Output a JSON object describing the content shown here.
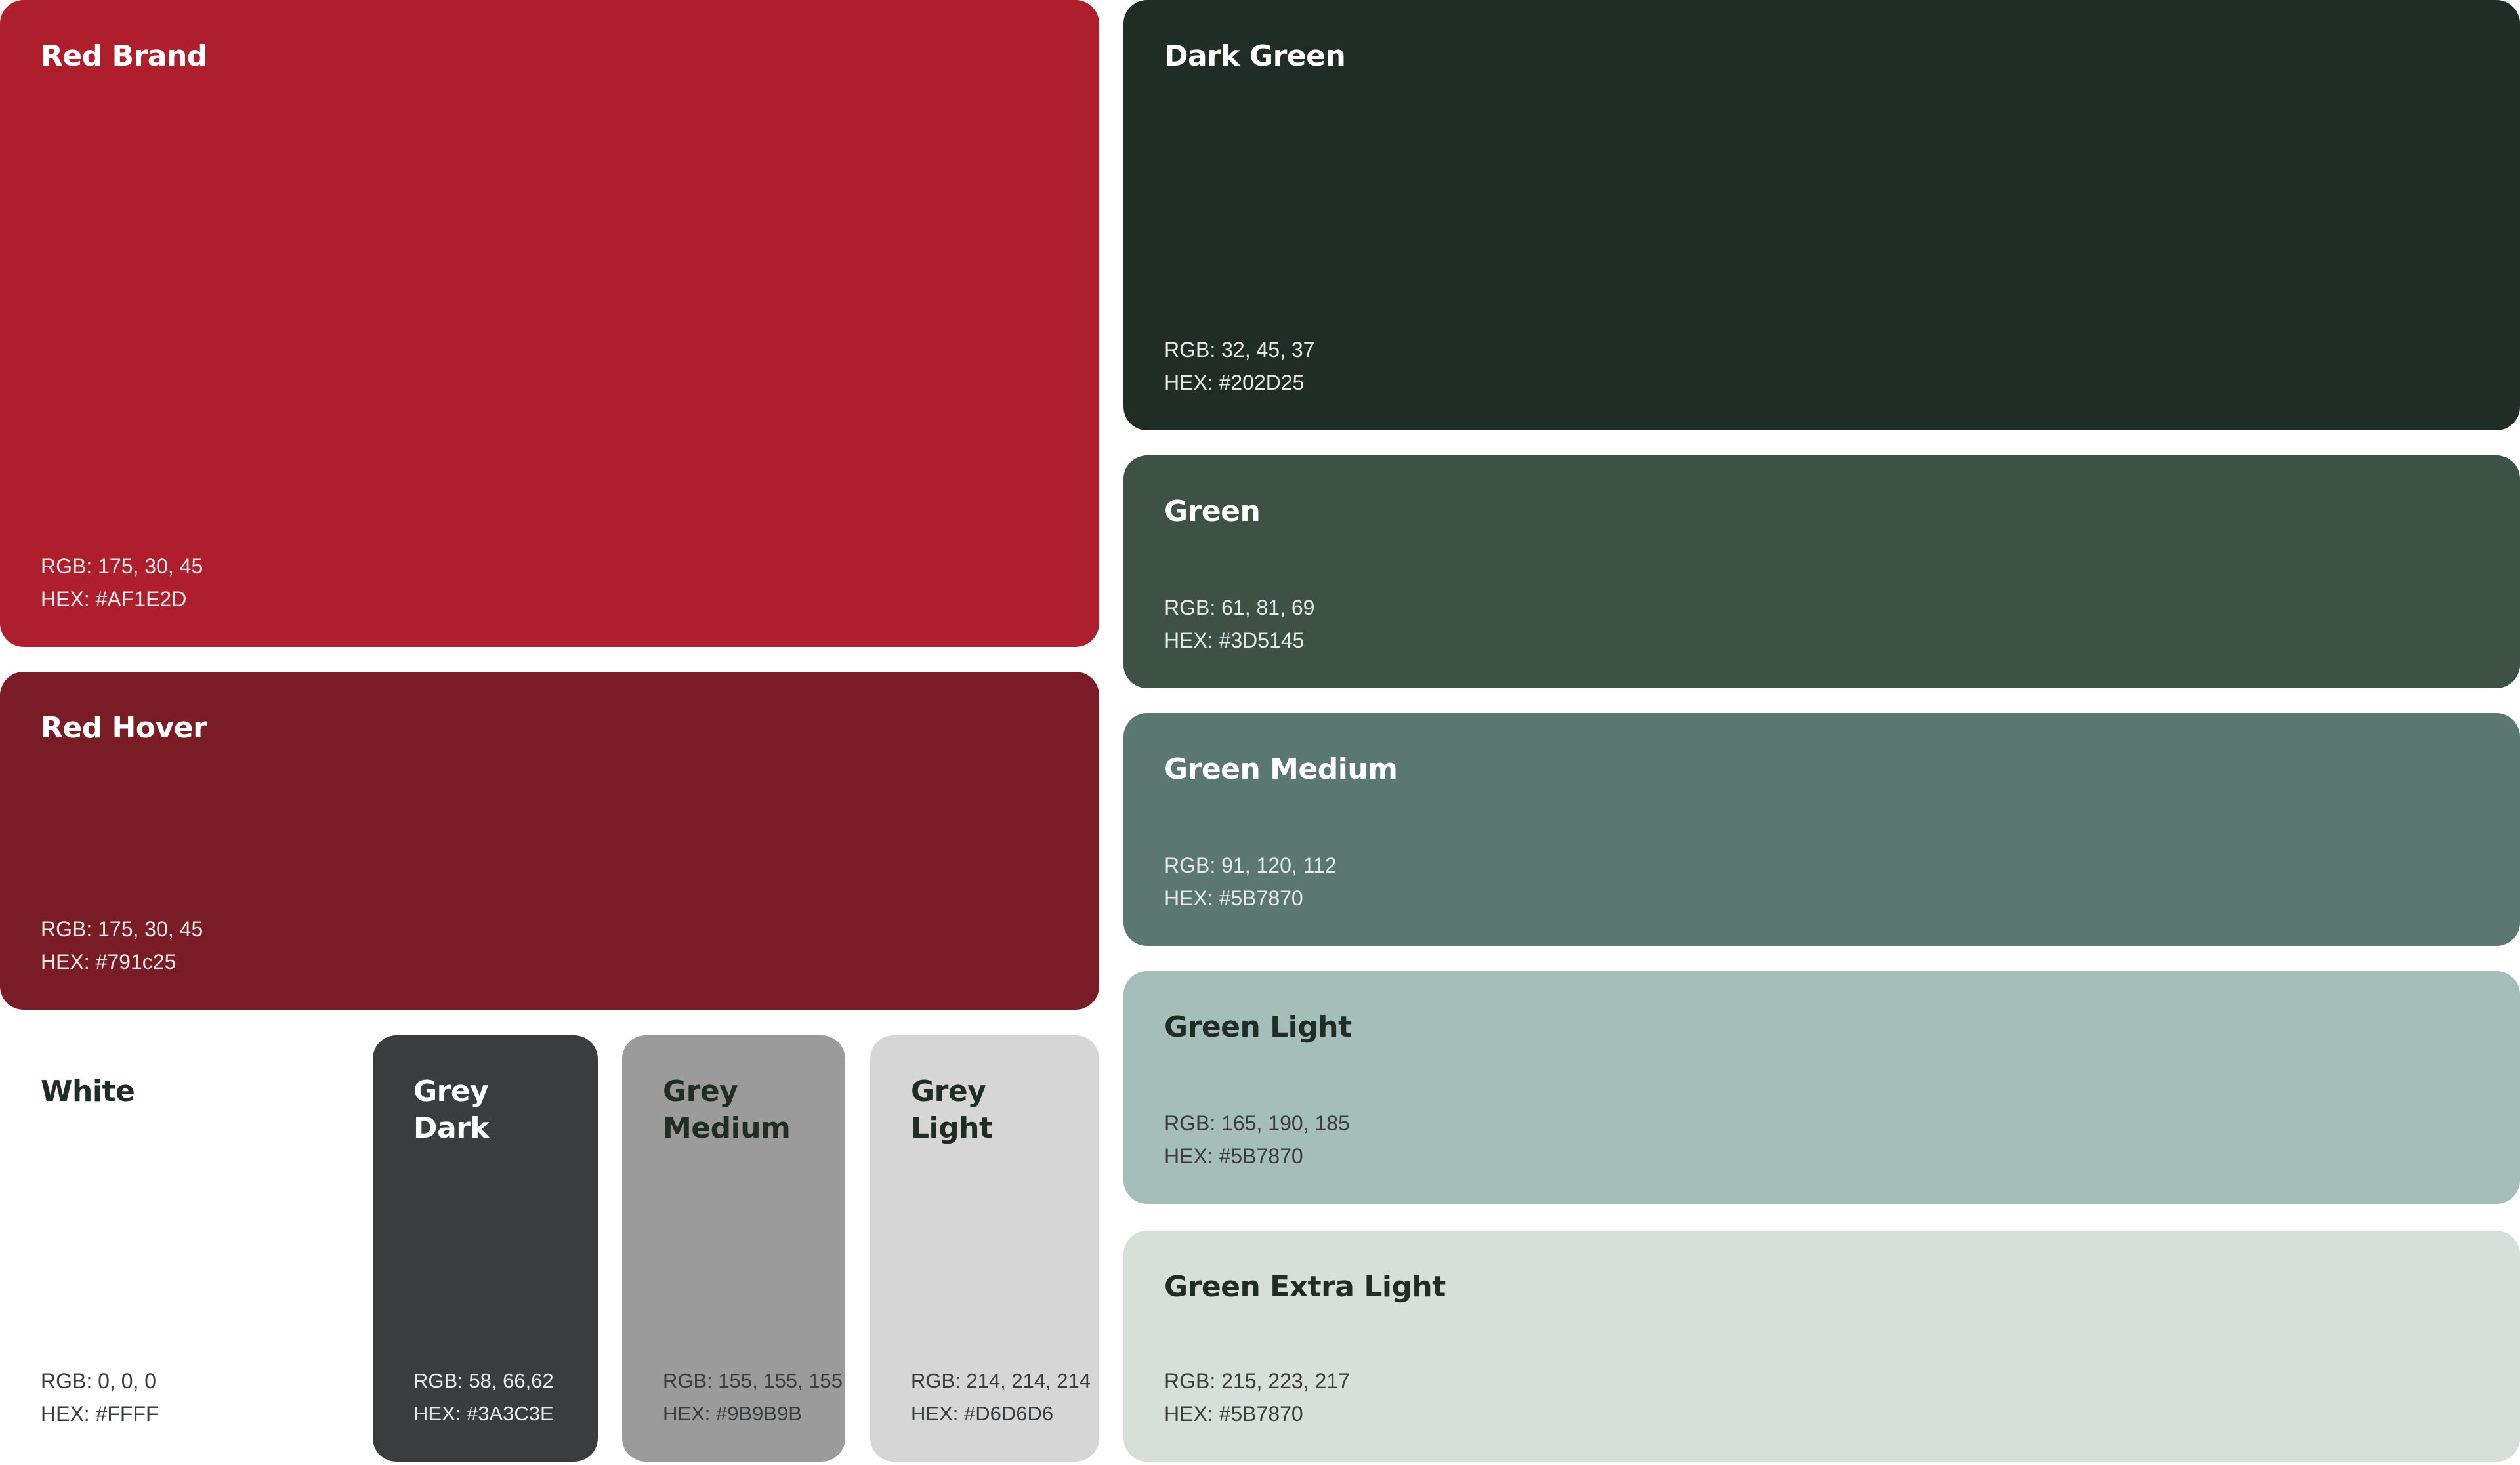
{
  "swatches": {
    "red_brand": {
      "name": "Red Brand",
      "rgb": "RGB: 175, 30, 45",
      "hex": "HEX: #AF1E2D",
      "color": "#AF1E2D"
    },
    "red_hover": {
      "name": "Red Hover",
      "rgb": "RGB: 175, 30, 45",
      "hex": "HEX: #791c25",
      "color": "#791C25"
    },
    "white": {
      "name": "White",
      "rgb": "RGB: 0, 0, 0",
      "hex": "HEX: #FFFF",
      "color": "#FFFFFF"
    },
    "grey_dark": {
      "name": "Grey\nDark",
      "rgb": "RGB: 58, 66,62",
      "hex": "HEX: #3A3C3E",
      "color": "#3A3C3E"
    },
    "grey_medium": {
      "name": "Grey\nMedium",
      "rgb": "RGB: 155, 155, 155",
      "hex": "HEX: #9B9B9B",
      "color": "#9B9B9B"
    },
    "grey_light": {
      "name": "Grey\nLight",
      "rgb": "RGB: 214, 214, 214",
      "hex": "HEX: #D6D6D6",
      "color": "#D6D6D6"
    },
    "dark_green": {
      "name": "Dark Green",
      "rgb": "RGB: 32, 45, 37",
      "hex": "HEX: #202D25",
      "color": "#202D25"
    },
    "green": {
      "name": "Green",
      "rgb": "RGB: 61, 81, 69",
      "hex": "HEX: #3D5145",
      "color": "#3D5145"
    },
    "green_medium": {
      "name": "Green Medium",
      "rgb": "RGB: 91, 120, 112",
      "hex": "HEX: #5B7870",
      "color": "#5B7870"
    },
    "green_light": {
      "name": "Green Light",
      "rgb": "RGB: 165, 190, 185",
      "hex": "HEX: #5B7870",
      "color": "#A5BEB9"
    },
    "green_xlight": {
      "name": "Green Extra Light",
      "rgb": "RGB: 215, 223, 217",
      "hex": "HEX: #5B7870",
      "color": "#D7DFD9"
    }
  }
}
